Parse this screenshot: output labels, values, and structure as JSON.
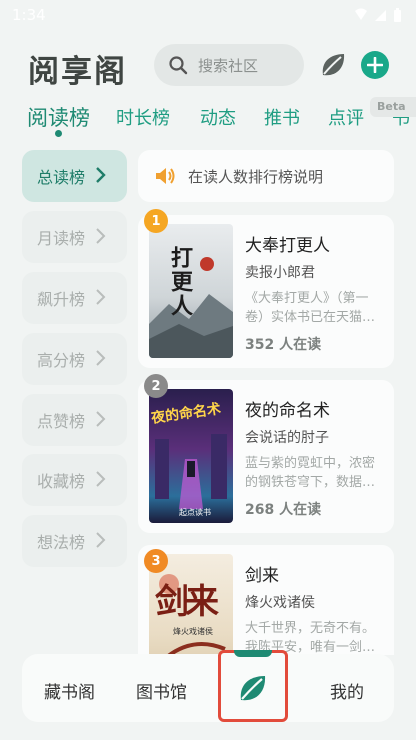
{
  "status_bar": {
    "time": "1:34"
  },
  "header": {
    "title": "阅享阁",
    "search_placeholder": "搜索社区"
  },
  "tabs": [
    {
      "label": "阅读榜"
    },
    {
      "label": "时长榜"
    },
    {
      "label": "动态"
    },
    {
      "label": "推书"
    },
    {
      "label": "点评"
    },
    {
      "label": "书"
    }
  ],
  "beta_badge": "Beta",
  "sidebar": [
    {
      "label": "总读榜"
    },
    {
      "label": "月读榜"
    },
    {
      "label": "飙升榜"
    },
    {
      "label": "高分榜"
    },
    {
      "label": "点赞榜"
    },
    {
      "label": "收藏榜"
    },
    {
      "label": "想法榜"
    }
  ],
  "notice": "在读人数排行榜说明",
  "books": [
    {
      "rank": "1",
      "title": "大奉打更人",
      "author": "卖报小郎君",
      "desc": "《大奉打更人》（第一卷）实体书已在天猫…",
      "readers": "352 人在读",
      "rank_color": "#f5a623",
      "cover_text": "打更人"
    },
    {
      "rank": "2",
      "title": "夜的命名术",
      "author": "会说话的肘子",
      "desc": "蓝与紫的霓虹中，浓密的钢铁苍穹下，数据…",
      "readers": "268 人在读",
      "rank_color": "#8a8a8a",
      "cover_text": "夜的命名术",
      "cover_footer": "起点读书"
    },
    {
      "rank": "3",
      "title": "剑来",
      "author": "烽火戏诸侯",
      "desc": "大千世界，无奇不有。我陈平安，唯有一剑…",
      "readers": "",
      "rank_color": "#f08a24",
      "cover_text": "剑来",
      "cover_sub": "烽火戏诸侯"
    }
  ],
  "bottom_nav": [
    {
      "label": "藏书阁"
    },
    {
      "label": "图书馆"
    },
    {
      "label": ""
    },
    {
      "label": "我的"
    }
  ],
  "colors": {
    "accent": "#1f8a73",
    "highlight_border": "#e24b3b"
  }
}
